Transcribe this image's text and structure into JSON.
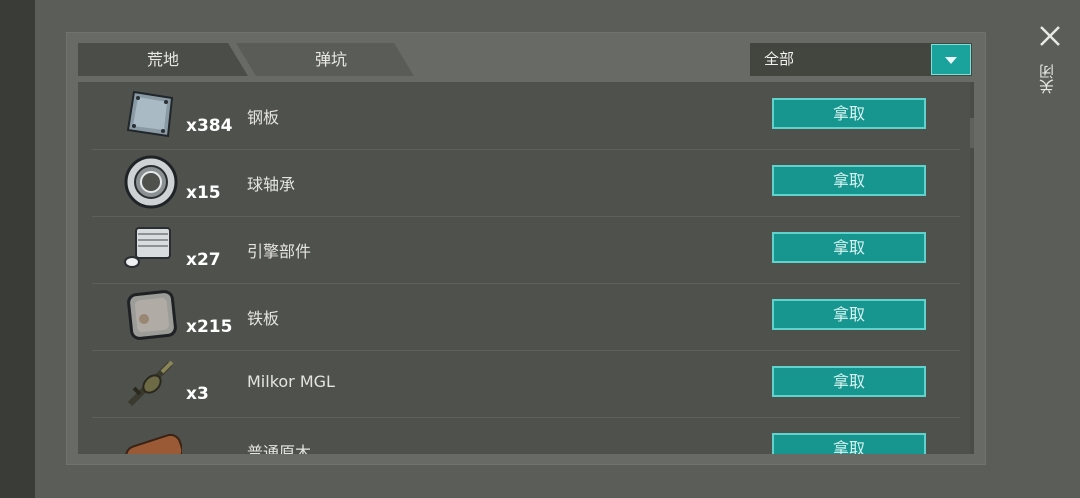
{
  "tabs": [
    {
      "label": "荒地"
    },
    {
      "label": "弹坑"
    }
  ],
  "filter": {
    "value": "全部"
  },
  "items": [
    {
      "name": "钢板",
      "qty": "x384",
      "icon": "steel-plate-icon",
      "action": "拿取"
    },
    {
      "name": "球轴承",
      "qty": "x15",
      "icon": "ball-bearing-icon",
      "action": "拿取"
    },
    {
      "name": "引擎部件",
      "qty": "x27",
      "icon": "engine-part-icon",
      "action": "拿取"
    },
    {
      "name": "铁板",
      "qty": "x215",
      "icon": "iron-plate-icon",
      "action": "拿取"
    },
    {
      "name": "Milkor MGL",
      "qty": "x3",
      "icon": "grenade-launcher-icon",
      "action": "拿取"
    },
    {
      "name": "普通原木",
      "qty": "",
      "icon": "log-icon",
      "action": "拿取"
    }
  ],
  "close": {
    "label": "关闭"
  },
  "colors": {
    "accent": "#19a39c",
    "panel": "#686a65",
    "list": "#4f514d"
  }
}
